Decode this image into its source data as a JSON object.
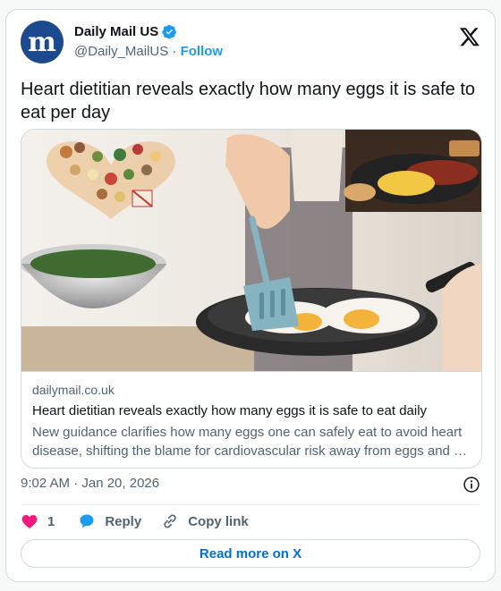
{
  "author": {
    "display_name": "Daily Mail US",
    "handle": "@Daily_MailUS",
    "separator": "·",
    "follow_label": "Follow",
    "avatar_glyph": "m",
    "avatar_color": "#1d4a8f",
    "verified_icon": "verified-badge-icon"
  },
  "brand_icon": "x-logo-icon",
  "tweet": {
    "text": "Heart dietitian reveals exactly how many eggs it is safe to eat per day"
  },
  "link_card": {
    "domain": "dailymail.co.uk",
    "title": "Heart dietitian reveals exactly how many eggs it is safe to eat daily",
    "description": "New guidance clarifies how many eggs one can safely eat to avoid heart disease, shifting the blame for cardiovascular risk away from eggs and …"
  },
  "meta": {
    "timestamp": "9:02 AM · Jan 20, 2026"
  },
  "actions": {
    "like_count": "1",
    "reply_label": "Reply",
    "copy_link_label": "Copy link",
    "read_more_label": "Read more on X"
  },
  "colors": {
    "accent": "#1d9bf0",
    "like": "#f91880",
    "link_button_text": "#006fd6"
  }
}
